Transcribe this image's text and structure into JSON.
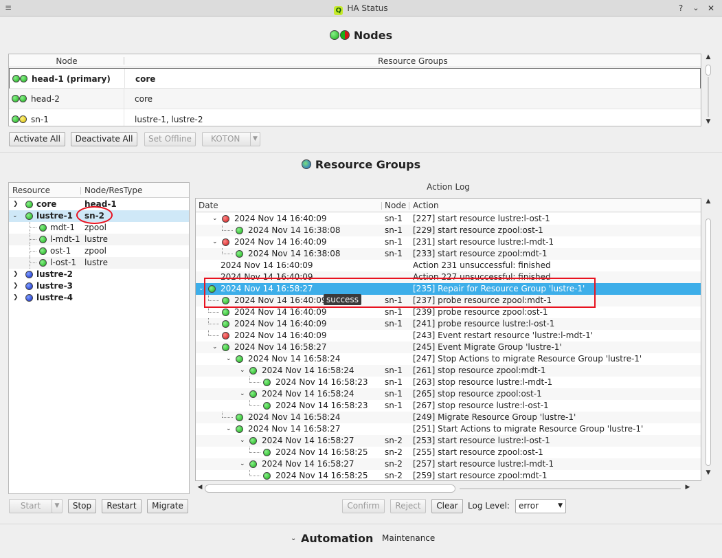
{
  "window": {
    "title": "HA Status",
    "menu_glyph": "≡",
    "logo_letter": "Q",
    "help_glyph": "?",
    "min_glyph": "⌄",
    "max_glyph": "☐",
    "close_glyph": "✕"
  },
  "nodes": {
    "title": "Nodes",
    "col_node": "Node",
    "col_groups": "Resource Groups",
    "rows": [
      {
        "name": "head-1 (primary)",
        "groups": "core",
        "bold": true,
        "led1": "green",
        "led2": "green"
      },
      {
        "name": "head-2",
        "groups": "core",
        "bold": false,
        "led1": "green",
        "led2": "green"
      },
      {
        "name": "sn-1",
        "groups": "lustre-1, lustre-2",
        "bold": false,
        "led1": "green",
        "led2": "yellow"
      }
    ],
    "buttons": {
      "activate_all": "Activate All",
      "deactivate_all": "Deactivate All",
      "set_offline": "Set Offline",
      "koton": "KOTON"
    }
  },
  "resource_groups": {
    "title": "Resource Groups",
    "col_resource": "Resource",
    "col_node_type": "Node/ResType",
    "tree": [
      {
        "label": "core",
        "info": "head-1",
        "level": 0,
        "expander": ">",
        "led": "green",
        "bold": true
      },
      {
        "label": "lustre-1",
        "info": "sn-2",
        "level": 0,
        "expander": "v",
        "led": "green",
        "bold": true
      },
      {
        "label": "mdt-1",
        "info": "zpool",
        "level": 1,
        "expander": "",
        "led": "green",
        "bold": false
      },
      {
        "label": "l-mdt-1",
        "info": "lustre",
        "level": 1,
        "expander": "",
        "led": "green",
        "bold": false
      },
      {
        "label": "ost-1",
        "info": "zpool",
        "level": 1,
        "expander": "",
        "led": "green",
        "bold": false
      },
      {
        "label": "l-ost-1",
        "info": "lustre",
        "level": 1,
        "expander": "",
        "led": "green",
        "bold": false
      },
      {
        "label": "lustre-2",
        "info": "",
        "level": 0,
        "expander": ">",
        "led": "blue",
        "bold": true
      },
      {
        "label": "lustre-3",
        "info": "",
        "level": 0,
        "expander": ">",
        "led": "blue",
        "bold": true
      },
      {
        "label": "lustre-4",
        "info": "",
        "level": 0,
        "expander": ">",
        "led": "blue",
        "bold": true
      }
    ],
    "buttons": {
      "start": "Start",
      "stop": "Stop",
      "restart": "Restart",
      "migrate": "Migrate"
    }
  },
  "action_log": {
    "title": "Action Log",
    "col_date": "Date",
    "col_node": "Node",
    "col_action": "Action",
    "tooltip": "success",
    "rows": [
      {
        "depth": 1,
        "exp": "v",
        "led": "red",
        "date": "2024 Nov 14 16:40:09",
        "node": "sn-1",
        "action": "[227] start resource lustre:l-ost-1"
      },
      {
        "depth": 2,
        "exp": "",
        "led": "green",
        "date": "2024 Nov 14 16:38:08",
        "node": "sn-1",
        "action": "[229] start resource zpool:ost-1"
      },
      {
        "depth": 1,
        "exp": "v",
        "led": "red",
        "date": "2024 Nov 14 16:40:09",
        "node": "sn-1",
        "action": "[231] start resource lustre:l-mdt-1"
      },
      {
        "depth": 2,
        "exp": "",
        "led": "green",
        "date": "2024 Nov 14 16:38:08",
        "node": "sn-1",
        "action": "[233] start resource zpool:mdt-1"
      },
      {
        "depth": 1,
        "exp": "",
        "led": "",
        "date": "2024 Nov 14 16:40:09",
        "node": "",
        "action": "Action 231 unsuccessful: finished"
      },
      {
        "depth": 1,
        "exp": "",
        "led": "",
        "date": "2024 Nov 14 16:40:09",
        "node": "",
        "action": "Action 227 unsuccessful: finished"
      },
      {
        "depth": 0,
        "exp": "v",
        "led": "green",
        "date": "2024 Nov 14 16:58:27",
        "node": "",
        "action": "[235] Repair for Resource Group 'lustre-1'",
        "selected": true
      },
      {
        "depth": 1,
        "exp": "",
        "led": "green",
        "date": "2024 Nov 14 16:40:09",
        "node": "sn-1",
        "action": "[237] probe resource zpool:mdt-1"
      },
      {
        "depth": 1,
        "exp": "",
        "led": "green",
        "date": "2024 Nov 14 16:40:09",
        "node": "sn-1",
        "action": "[239] probe resource zpool:ost-1"
      },
      {
        "depth": 1,
        "exp": "",
        "led": "green",
        "date": "2024 Nov 14 16:40:09",
        "node": "sn-1",
        "action": "[241] probe resource lustre:l-ost-1"
      },
      {
        "depth": 1,
        "exp": "",
        "led": "red",
        "date": "2024 Nov 14 16:40:09",
        "node": "",
        "action": "[243] Event restart resource 'lustre:l-mdt-1'"
      },
      {
        "depth": 1,
        "exp": "v",
        "led": "green",
        "date": "2024 Nov 14 16:58:27",
        "node": "",
        "action": "[245] Event Migrate Group 'lustre-1'"
      },
      {
        "depth": 2,
        "exp": "v",
        "led": "green",
        "date": "2024 Nov 14 16:58:24",
        "node": "",
        "action": "[247] Stop Actions to migrate Resource Group 'lustre-1'"
      },
      {
        "depth": 3,
        "exp": "v",
        "led": "green",
        "date": "2024 Nov 14 16:58:24",
        "node": "sn-1",
        "action": "[261] stop resource zpool:mdt-1"
      },
      {
        "depth": 4,
        "exp": "",
        "led": "green",
        "date": "2024 Nov 14 16:58:23",
        "node": "sn-1",
        "action": "[263] stop resource lustre:l-mdt-1"
      },
      {
        "depth": 3,
        "exp": "v",
        "led": "green",
        "date": "2024 Nov 14 16:58:24",
        "node": "sn-1",
        "action": "[265] stop resource zpool:ost-1"
      },
      {
        "depth": 4,
        "exp": "",
        "led": "green",
        "date": "2024 Nov 14 16:58:23",
        "node": "sn-1",
        "action": "[267] stop resource lustre:l-ost-1"
      },
      {
        "depth": 2,
        "exp": "",
        "led": "green",
        "date": "2024 Nov 14 16:58:24",
        "node": "",
        "action": "[249] Migrate Resource Group 'lustre-1'"
      },
      {
        "depth": 2,
        "exp": "v",
        "led": "green",
        "date": "2024 Nov 14 16:58:27",
        "node": "",
        "action": "[251] Start Actions to migrate Resource Group 'lustre-1'"
      },
      {
        "depth": 3,
        "exp": "v",
        "led": "green",
        "date": "2024 Nov 14 16:58:27",
        "node": "sn-2",
        "action": "[253] start resource lustre:l-ost-1"
      },
      {
        "depth": 4,
        "exp": "",
        "led": "green",
        "date": "2024 Nov 14 16:58:25",
        "node": "sn-2",
        "action": "[255] start resource zpool:ost-1"
      },
      {
        "depth": 3,
        "exp": "v",
        "led": "green",
        "date": "2024 Nov 14 16:58:27",
        "node": "sn-2",
        "action": "[257] start resource lustre:l-mdt-1"
      },
      {
        "depth": 4,
        "exp": "",
        "led": "green",
        "date": "2024 Nov 14 16:58:25",
        "node": "sn-2",
        "action": "[259] start resource zpool:mdt-1"
      }
    ],
    "buttons": {
      "confirm": "Confirm",
      "reject": "Reject",
      "clear": "Clear"
    },
    "log_level_label": "Log Level:",
    "log_level_value": "error"
  },
  "automation": {
    "title": "Automation",
    "mode": "Maintenance"
  },
  "colors": {
    "selection": "#3daee9",
    "highlight_box": "#e8121f",
    "led_green": "#19b019",
    "led_red": "#d01818",
    "led_blue": "#1028c8",
    "led_yellow": "#d8c000"
  }
}
